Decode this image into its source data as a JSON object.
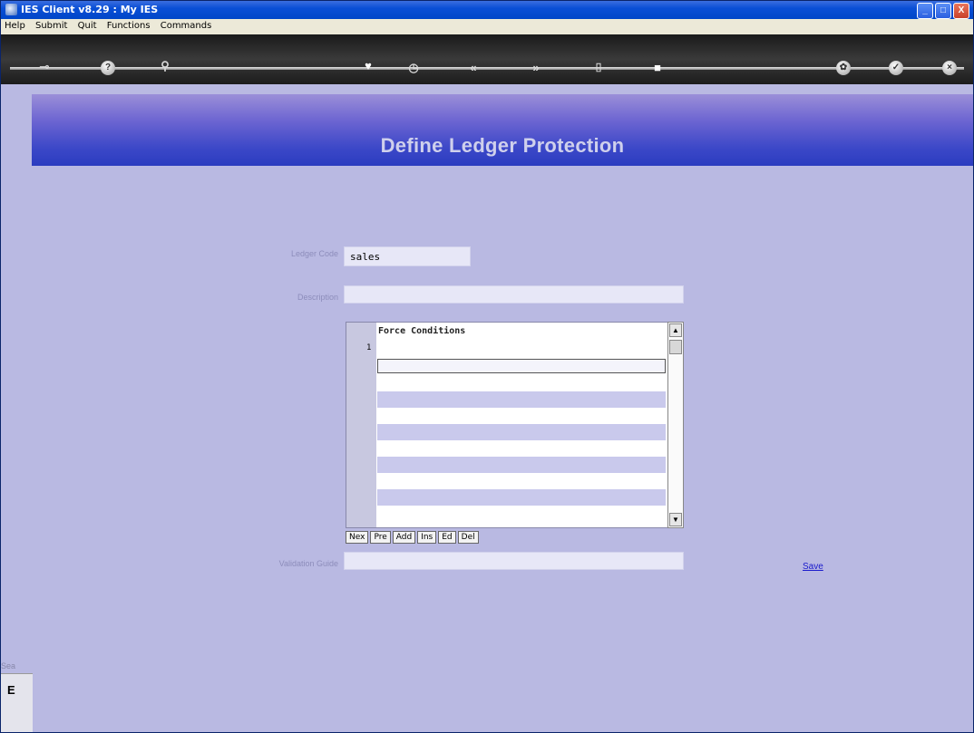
{
  "window": {
    "title": "IES Client v8.29 : My IES",
    "buttons": [
      "_",
      "□",
      "X"
    ]
  },
  "menu": [
    "Help",
    "Submit",
    "Quit",
    "Functions",
    "Commands"
  ],
  "toolbar": {
    "icons": [
      "key-icon",
      "help-icon",
      "search-icon",
      "heart-icon",
      "clock-icon",
      "rewind-icon",
      "forward-icon",
      "bracket-icon",
      "stop-icon",
      "gear-icon",
      "check-icon",
      "close-icon"
    ]
  },
  "page": {
    "title": "Define Ledger Protection"
  },
  "form": {
    "ledger_code_label": "Ledger Code",
    "ledger_code_value": "sales",
    "description_label": "Description",
    "description_value": "",
    "validation_label": "Validation Guide",
    "validation_value": ""
  },
  "grid": {
    "header": "Force Conditions",
    "row_number": "1",
    "buttons": [
      "Nex",
      "Pre",
      "Add",
      "Ins",
      "Ed",
      "Del"
    ]
  },
  "actions": {
    "save": "Save"
  },
  "bottom": {
    "s1": "Sea",
    "s2": "E"
  }
}
